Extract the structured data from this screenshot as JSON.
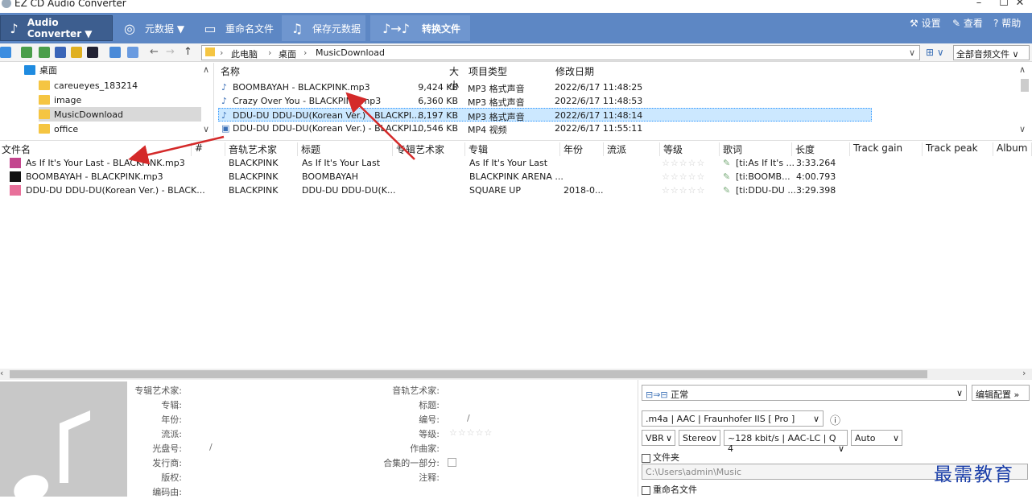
{
  "app": {
    "title": "EZ CD Audio Converter",
    "min": "–",
    "max": "☐",
    "close": "✕"
  },
  "ribbon": {
    "audio_converter": "Audio Converter ▼",
    "metadata": "元数据 ▼",
    "rename": "重命名文件",
    "save_meta": "保存元数据",
    "convert": "转换文件",
    "settings": "设置",
    "view": "查看",
    "help": "帮助"
  },
  "nav": {
    "back": "←",
    "forward": "→",
    "up": "↑",
    "path": [
      "此电脑",
      "桌面",
      "MusicDownload"
    ],
    "sep": "›",
    "filter": "全部音频文件 ∨",
    "collapse": "∨"
  },
  "folders": [
    "桌面",
    "careueyes_183214",
    "image",
    "MusicDownload",
    "office"
  ],
  "files": {
    "headers": [
      "名称",
      "大小",
      "项目类型",
      "修改日期"
    ],
    "rows": [
      [
        "BOOMBAYAH - BLACKPINK.mp3",
        "9,424 KB",
        "MP3 格式声音",
        "2022/6/17 11:48:25"
      ],
      [
        "Crazy Over You - BLACKPINK.mp3",
        "6,360 KB",
        "MP3 格式声音",
        "2022/6/17 11:48:53"
      ],
      [
        "DDU-DU DDU-DU(Korean Ver.) - BLACKPI...",
        "8,197 KB",
        "MP3 格式声音",
        "2022/6/17 11:48:14"
      ],
      [
        "DDU-DU DDU-DU(Korean Ver.) - BLACKPI...",
        "10,546 KB",
        "MP4 视频",
        "2022/6/17 11:55:11"
      ]
    ]
  },
  "grid": {
    "headers": [
      "文件名",
      "#",
      "音轨艺术家",
      "标题",
      "专辑艺术家",
      "专辑",
      "年份",
      "流派",
      "等级",
      "歌词",
      "长度",
      "Track gain",
      "Track peak",
      "Album ga"
    ],
    "rows": [
      {
        "file": "As If It's Your Last - BLACKPINK.mp3",
        "artist": "BLACKPINK",
        "title": "As If It's Your Last",
        "album": "As If It's Your Last",
        "year": "",
        "stars": "☆☆☆☆☆",
        "lyrics": "[ti:As If It's ...",
        "length": "3:33.264"
      },
      {
        "file": "BOOMBAYAH - BLACKPINK.mp3",
        "artist": "BLACKPINK",
        "title": "BOOMBAYAH",
        "album": "BLACKPINK ARENA ...",
        "year": "",
        "stars": "☆☆☆☆☆",
        "lyrics": "[ti:BOOMB...",
        "length": "4:00.793"
      },
      {
        "file": "DDU-DU DDU-DU(Korean Ver.) - BLACK...",
        "artist": "BLACKPINK",
        "title": "DDU-DU DDU-DU(K...",
        "album": "SQUARE UP",
        "year": "2018-0...",
        "stars": "☆☆☆☆☆",
        "lyrics": "[ti:DDU-DU ...",
        "length": "3:29.398"
      }
    ]
  },
  "meta": {
    "left": [
      "专辑艺术家:",
      "专辑:",
      "年份:",
      "流派:",
      "光盘号:",
      "发行商:",
      "版权:",
      "编码由:"
    ],
    "disc_sep": "/",
    "right": [
      "音轨艺术家:",
      "标题:",
      "编号:",
      "等级:",
      "作曲家:",
      "合集的一部分:",
      "注释:"
    ],
    "track_sep": "/",
    "stars": "☆☆☆☆☆"
  },
  "convert": {
    "profile": "正常",
    "edit": "编辑配置 »",
    "format": ".m4a | AAC | Fraunhofer IIS [ Pro ]",
    "vbr": "VBR",
    "stereo": "Stereo",
    "bitrate": "~128 kbit/s | AAC-LC | Q 4",
    "auto": "Auto",
    "folder_label": "文件夹",
    "folder_path": "C:\\Users\\admin\\Music",
    "rename_label": "重命名文件",
    "info": "ⓘ"
  },
  "watermark": "最需教育"
}
